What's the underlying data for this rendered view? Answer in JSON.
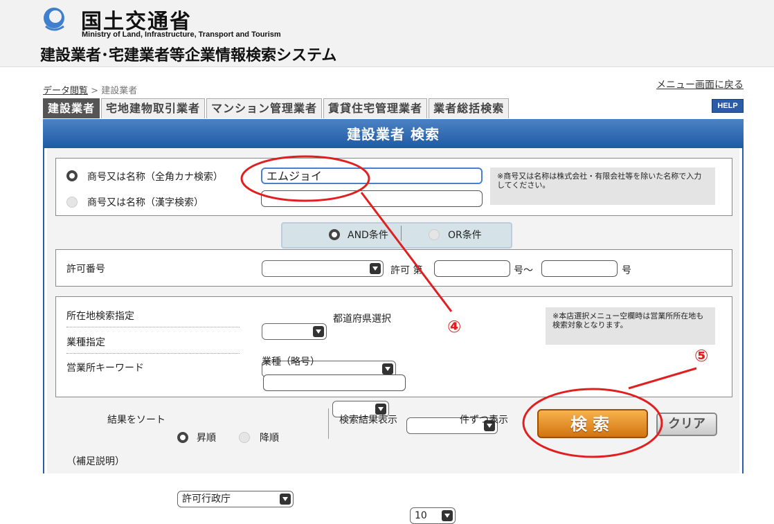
{
  "header": {
    "ministry_jp": "国土交通省",
    "ministry_en": "Ministry of Land, Infrastructure, Transport and Tourism",
    "system_title": "建設業者･宅建業者等企業情報検索システム"
  },
  "breadcrumb": {
    "link": "データ閲覧",
    "sep": ">",
    "current": "建設業者"
  },
  "back_link": "メニュー画面に戻る",
  "tabs": [
    "建設業者",
    "宅地建物取引業者",
    "マンション管理業者",
    "賃貸住宅管理業者",
    "業者総括検索"
  ],
  "help": "HELP",
  "panel_title": "建設業者 検索",
  "name_search": {
    "kana_label": "商号又は名称（全角カナ検索）",
    "kanji_label": "商号又は名称（漢字検索）",
    "kana_value": "エムジョイ",
    "kanji_value": "",
    "note": "※商号又は名称は株式会社・有限会社等を除いた名称で入力してください。"
  },
  "logic": {
    "and": "AND条件",
    "or": "OR条件"
  },
  "permit": {
    "label": "許可番号",
    "mid": "許可 第",
    "suffix1": "号～",
    "suffix2": "号"
  },
  "location": {
    "location_label": "所在地検索指定",
    "pref_label": "都道府県選択",
    "industry_label": "業種指定",
    "office_label": "営業所キーワード",
    "industry_abbr_label": "業種（略号）",
    "note": "※本店選択メニュー空欄時は営業所所在地も検索対象となります。"
  },
  "sort": {
    "label": "結果をソート",
    "value": "許可行政庁",
    "asc": "昇順",
    "desc": "降順"
  },
  "display": {
    "label": "検索結果表示",
    "value": "10",
    "suffix": "件ずつ表示"
  },
  "buttons": {
    "search": "検索",
    "clear": "クリア"
  },
  "supplement": "（補足説明）",
  "annotations": {
    "four": "④",
    "five": "⑤"
  },
  "colors": {
    "accent_blue": "#2a5ca8",
    "annotation_red": "#e02020",
    "search_orange": "#e8901e"
  }
}
